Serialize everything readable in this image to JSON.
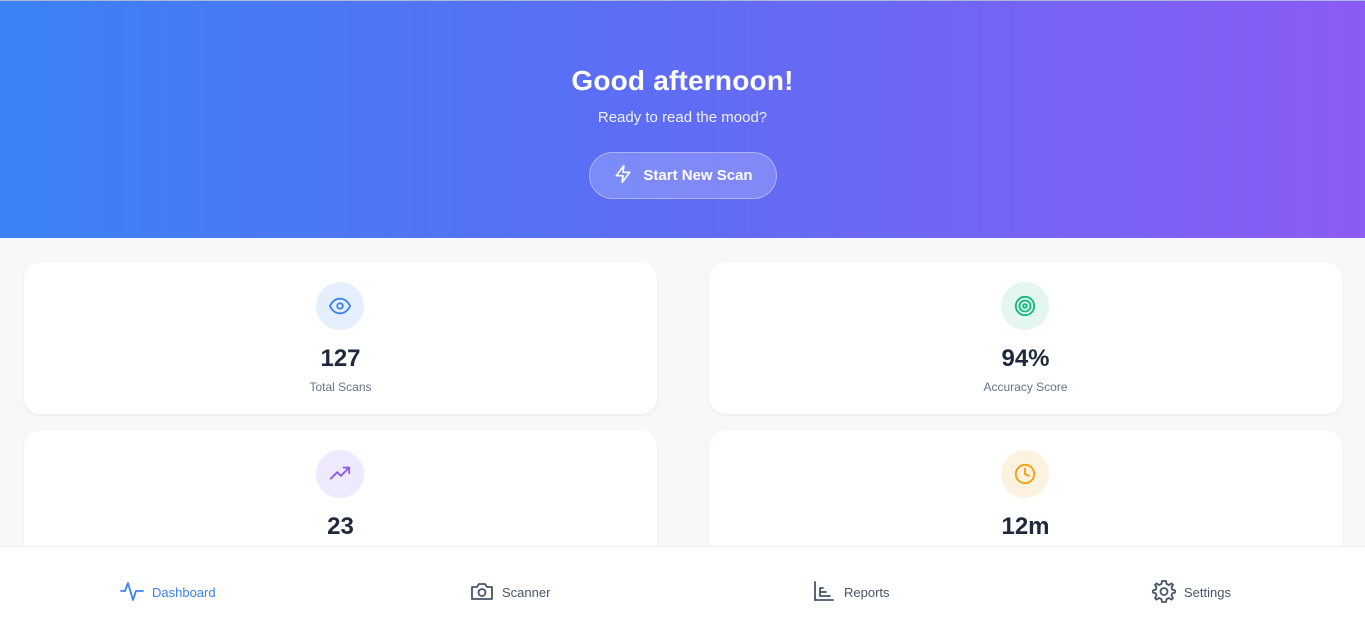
{
  "hero": {
    "title": "Good afternoon!",
    "subtitle": "Ready to read the mood?",
    "button_label": "Start New Scan",
    "button_icon": "lightning-icon"
  },
  "stats": [
    {
      "value": "127",
      "label": "Total Scans",
      "icon": "eye-icon",
      "icon_color": "#3b82f6",
      "icon_bg": "#e6effd"
    },
    {
      "value": "94%",
      "label": "Accuracy Score",
      "icon": "target-icon",
      "icon_color": "#10b981",
      "icon_bg": "#e3f6ef"
    },
    {
      "value": "23",
      "label": "",
      "icon": "trending-up-icon",
      "icon_color": "#8b5cf6",
      "icon_bg": "#efe9fd"
    },
    {
      "value": "12m",
      "label": "",
      "icon": "clock-icon",
      "icon_color": "#f59e0b",
      "icon_bg": "#fdf1e0"
    }
  ],
  "nav": {
    "active": "Dashboard",
    "items": [
      {
        "label": "Dashboard",
        "icon": "activity-icon"
      },
      {
        "label": "Scanner",
        "icon": "camera-icon"
      },
      {
        "label": "Reports",
        "icon": "bar-chart-icon"
      },
      {
        "label": "Settings",
        "icon": "gear-icon"
      }
    ]
  },
  "colors": {
    "gradient_start": "#3b82f6",
    "gradient_end": "#8b5cf6",
    "accent": "#3b82f6",
    "text_dark": "#1e293b",
    "text_muted": "#64748b"
  }
}
